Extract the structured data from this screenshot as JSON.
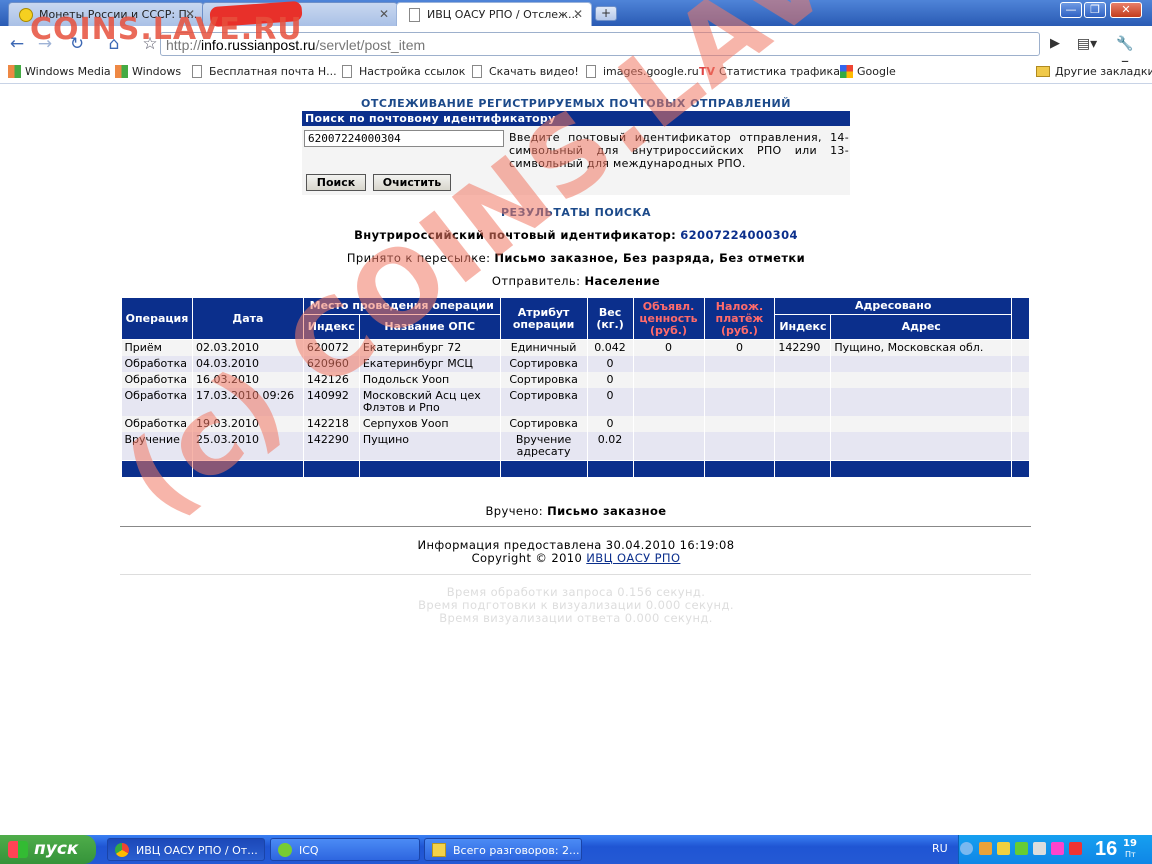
{
  "browser": {
    "tabs": [
      {
        "title": "Монеты России и СССР: П...",
        "active": false
      },
      {
        "title": "",
        "active": false
      },
      {
        "title": "ИВЦ ОАСУ РПО / Отслеж...",
        "active": true
      }
    ],
    "address": {
      "prefix": "http://",
      "host": "info.russianpost.ru",
      "path": "/servlet/post_item"
    },
    "bookmarks": [
      "Windows Media",
      "Windows",
      "Бесплатная почта Н...",
      "Настройка ссылок",
      "Скачать видео!",
      "images.google.ru",
      "Статистика трафика",
      "Google"
    ],
    "other_bookmarks": "Другие закладки"
  },
  "watermark": {
    "top": "COINS.LAVE.RU",
    "diagonal": "(c) COINS.LAVE.RU"
  },
  "page": {
    "title": "ОТСЛЕЖИВАНИЕ РЕГИСТРИРУЕМЫХ ПОЧТОВЫХ ОТПРАВЛЕНИЙ",
    "search": {
      "header": "Поиск по почтовому идентификатору",
      "value": "62007224000304",
      "hint": "Введите почтовый идентификатор отправления, 14-символьный для внутрироссийских РПО или 13-символьный для международных РПО.",
      "search_button": "Поиск",
      "clear_button": "Очистить"
    },
    "results_title": "РЕЗУЛЬТАТЫ ПОИСКА",
    "id_label": "Внутрироссийский почтовый идентификатор:",
    "id_value": "62007224000304",
    "accepted_label": "Принято к пересылке:",
    "accepted_value": "Письмо заказное, Без разряда, Без отметки",
    "sender_label": "Отправитель:",
    "sender_value": "Население",
    "table": {
      "headers": {
        "operation": "Операция",
        "date": "Дата",
        "place": "Место проведения операции",
        "index": "Индекс",
        "ops_name": "Название ОПС",
        "attribute": "Атрибут операции",
        "weight": "Вес (кг.)",
        "declared": "Объявл. ценность (руб.)",
        "cod": "Налож. платёж (руб.)",
        "addressed": "Адресовано",
        "addr_index": "Индекс",
        "address": "Адрес"
      },
      "rows": [
        {
          "op": "Приём",
          "date": "02.03.2010",
          "index": "620072",
          "name": "Екатеринбург 72",
          "attr": "Единичный",
          "weight": "0.042",
          "declared": "0",
          "cod": "0",
          "addr_index": "142290",
          "address": "Пущино, Московская обл."
        },
        {
          "op": "Обработка",
          "date": "04.03.2010",
          "index": "620960",
          "name": "Екатеринбург МСЦ",
          "attr": "Сортировка",
          "weight": "0",
          "declared": "",
          "cod": "",
          "addr_index": "",
          "address": ""
        },
        {
          "op": "Обработка",
          "date": "16.03.2010",
          "index": "142126",
          "name": "Подольск Уооп",
          "attr": "Сортировка",
          "weight": "0",
          "declared": "",
          "cod": "",
          "addr_index": "",
          "address": ""
        },
        {
          "op": "Обработка",
          "date": "17.03.2010 09:26",
          "index": "140992",
          "name": "Московский Асц цех Флэтов и Рпо",
          "attr": "Сортировка",
          "weight": "0",
          "declared": "",
          "cod": "",
          "addr_index": "",
          "address": ""
        },
        {
          "op": "Обработка",
          "date": "19.03.2010",
          "index": "142218",
          "name": "Серпухов Уооп",
          "attr": "Сортировка",
          "weight": "0",
          "declared": "",
          "cod": "",
          "addr_index": "",
          "address": ""
        },
        {
          "op": "Вручение",
          "date": "25.03.2010",
          "index": "142290",
          "name": "Пущино",
          "attr": "Вручение адресату",
          "weight": "0.02",
          "declared": "",
          "cod": "",
          "addr_index": "",
          "address": ""
        }
      ]
    },
    "delivered_label": "Вручено:",
    "delivered_value": "Письмо заказное",
    "info_line": "Информация предоставлена 30.04.2010 16:19:08",
    "copyright_prefix": "Copyright © 2010",
    "copyright_link": "ИВЦ ОАСУ РПО",
    "timing": [
      "Время обработки запроса 0.156 секунд.",
      "Время подготовки к визуализации 0.000 секунд.",
      "Время визуализации ответа 0.000 секунд."
    ]
  },
  "taskbar": {
    "start": "пуск",
    "tasks": [
      "ИВЦ ОАСУ РПО / От...",
      "ICQ",
      "Всего разговоров: 2..."
    ],
    "lang": "RU",
    "clock_hour": "16",
    "clock_min": "19",
    "clock_day": "Пт"
  },
  "colors": {
    "header_blue": "#0b2f8c",
    "link_blue": "#0b2f8c",
    "title_blue": "#1c4a8a",
    "start_green": "#3b9c3a"
  }
}
